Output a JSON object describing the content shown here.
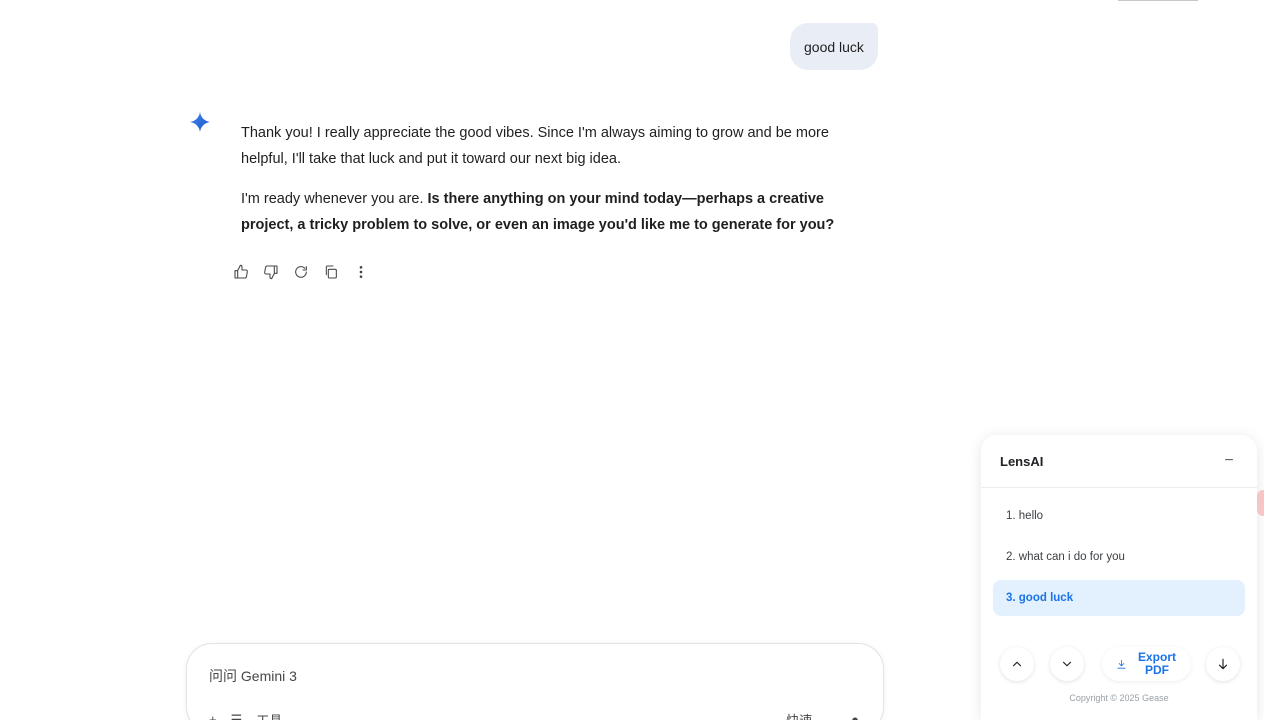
{
  "user_message": "good luck",
  "reply": {
    "paragraph1": "Thank you! I really appreciate the good vibes. Since I'm always aiming to grow and be more helpful, I'll take that luck and put it toward our next big idea.",
    "paragraph2_plain": "I'm ready whenever you are. ",
    "paragraph2_bold": "Is there anything on your mind today—perhaps a creative project, a tricky problem to solve, or even an image you'd like me to generate for you?"
  },
  "response_actions": [
    "thumb-up-icon",
    "thumb-down-icon",
    "refresh-icon",
    "copy-icon",
    "more-vert-icon"
  ],
  "input": {
    "placeholder": "问问 Gemini 3",
    "tools_label": "工具",
    "mode_label": "快速"
  },
  "lens_panel": {
    "title": "LensAI",
    "minimize_symbol": "−",
    "items": [
      {
        "label": "1. hello",
        "active": false
      },
      {
        "label": "2. what can i do for you",
        "active": false
      },
      {
        "label": "3. good luck",
        "active": true
      }
    ],
    "export_label": "Export PDF",
    "copyright": "Copyright © 2025 Gease",
    "accent_color": "#1a73e8"
  }
}
